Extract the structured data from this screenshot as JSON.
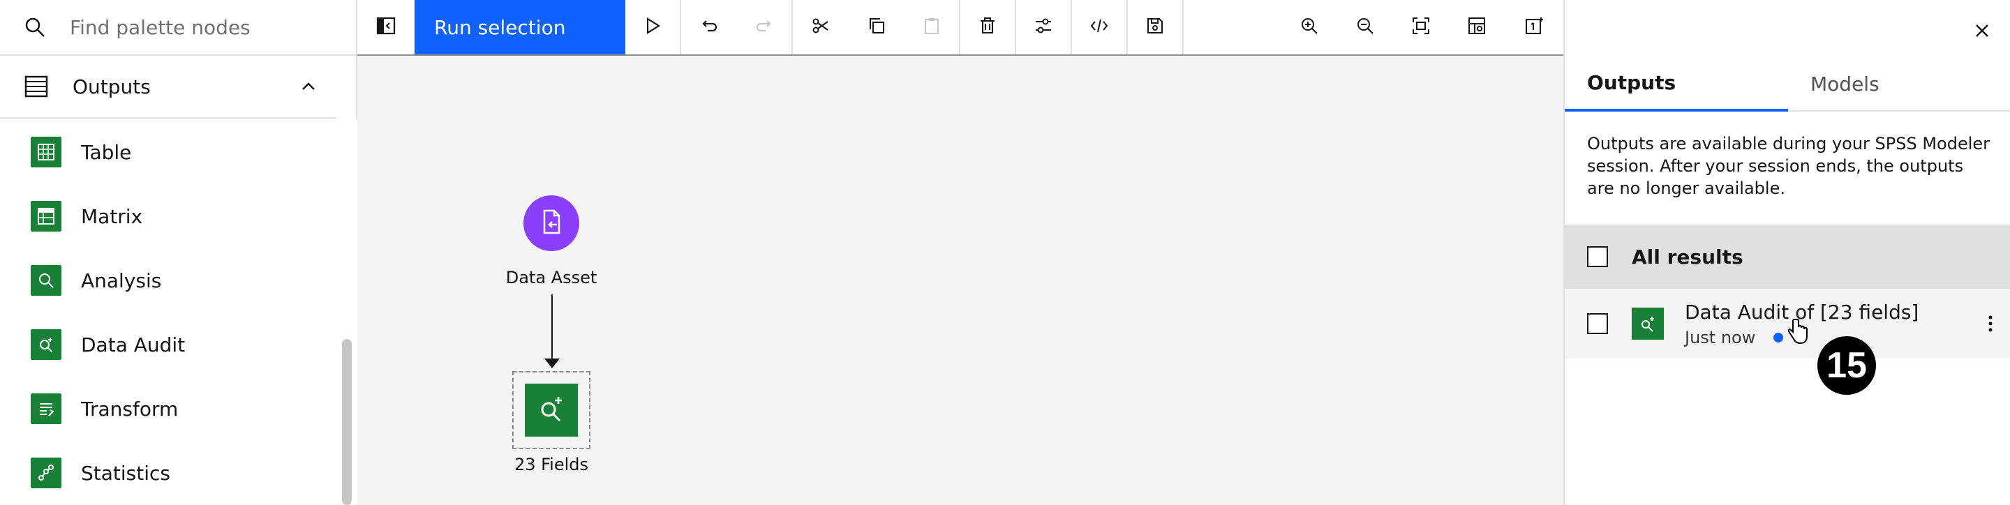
{
  "palette": {
    "search_placeholder": "Find palette nodes",
    "category": {
      "label": "Outputs"
    },
    "items": [
      {
        "label": "Table",
        "icon": "table-icon"
      },
      {
        "label": "Matrix",
        "icon": "matrix-icon"
      },
      {
        "label": "Analysis",
        "icon": "analysis-icon"
      },
      {
        "label": "Data Audit",
        "icon": "data-audit-icon"
      },
      {
        "label": "Transform",
        "icon": "transform-icon"
      },
      {
        "label": "Statistics",
        "icon": "statistics-icon"
      }
    ]
  },
  "toolbar": {
    "run_label": "Run selection",
    "icons": [
      "palette-toggle-icon",
      "run-icon",
      "undo-icon",
      "redo-icon",
      "cut-icon",
      "copy-icon",
      "paste-icon",
      "delete-icon",
      "settings-icon",
      "code-icon",
      "save-icon",
      "zoom-in-icon",
      "zoom-out-icon",
      "fit-to-screen-icon",
      "arrange-icon",
      "node-count-icon"
    ]
  },
  "canvas": {
    "nodes": [
      {
        "label": "Data Asset",
        "icon": "data-asset-icon"
      },
      {
        "label": "23 Fields",
        "icon": "data-audit-icon"
      }
    ]
  },
  "panel": {
    "tabs": [
      "Outputs",
      "Models"
    ],
    "active_tab": "Outputs",
    "description": "Outputs are available during your SPSS Modeler session. After your session ends, the outputs are no longer available.",
    "all_results_label": "All results",
    "results": [
      {
        "title": "Data Audit of [23 fields]",
        "subtitle": "Just now",
        "status": "new"
      }
    ]
  },
  "annotation": {
    "step_number": "15"
  },
  "colors": {
    "accent": "#0f62fe",
    "node_green": "#198038",
    "node_purple": "#8a3ffc"
  }
}
